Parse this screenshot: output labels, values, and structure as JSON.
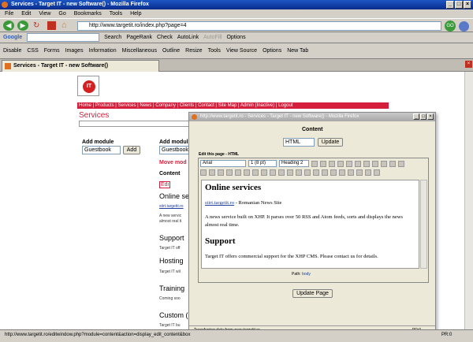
{
  "window": {
    "title": "Services - Target IT - new Software() - Mozilla Firefox"
  },
  "menu": [
    "File",
    "Edit",
    "View",
    "Go",
    "Bookmarks",
    "Tools",
    "Help"
  ],
  "url": "http://www.targetit.ro/index.php?page=4",
  "google_toolbar": {
    "label": "Google",
    "items": [
      "Search",
      "PageRank",
      "Check",
      "AutoLink",
      "AutoFill",
      "Options"
    ]
  },
  "webdev_toolbar": [
    "Disable",
    "CSS",
    "Forms",
    "Images",
    "Information",
    "Miscellaneous",
    "Outline",
    "Resize",
    "Tools",
    "View Source",
    "Options"
  ],
  "new_tab": "New Tab",
  "tab": {
    "title": "Services - Target IT - new Software()"
  },
  "site": {
    "nav": "Home | Products | Services | News | Company | Clients | Contact | Site Map | Admin (Inactive) | Logout",
    "page_title": "Services",
    "logo_text": "IT",
    "add_module_label": "Add module",
    "add_module_select": "Guestbook",
    "add_button": "Add",
    "add_module_label_2": "Add modul",
    "move_module": "Move mod",
    "content_label": "Content",
    "edit_link": "Edi",
    "sections": [
      {
        "heading": "Online se",
        "lines": [
          "stirt.targetit.ro",
          "A new servic",
          "almost real ti"
        ]
      },
      {
        "heading": "Support",
        "lines": [
          "Target IT off"
        ]
      },
      {
        "heading": "Hosting",
        "lines": [
          "Target IT wil"
        ]
      },
      {
        "heading": "Training",
        "lines": [
          "Coming soo"
        ]
      },
      {
        "heading": "Custom (",
        "lines": [
          "Target IT bu"
        ]
      }
    ]
  },
  "popup": {
    "title": "http://www.targetit.ro - Services - Target IT - new Software() - Mozilla Firefox",
    "content_label": "Content",
    "format_select": "HTML",
    "update_button": "Update",
    "edit_label": "Edit this page - HTML",
    "font_select": "Arial",
    "size_select": "1 (8 pt)",
    "heading_select": "Heading 2",
    "doc": {
      "h1": "Online services",
      "link": "stirt.targetit.ro",
      "link_suffix": " - Romanian News Site",
      "p2": "A news service built on XHP. It parses over 50 RSS and Atom feeds, sorts and displays the news almost real time.",
      "h2": "Support",
      "p3": "Target IT offers commercial support for the XHP CMS. Please contact us for details."
    },
    "path_label": "Path:",
    "path_value": "body",
    "update_page_button": "Update Page",
    "status": "Transferring data from www.targetit.ro...",
    "status_right": "PR:0"
  },
  "statusbar": {
    "text": "http://www.targetit.ro/editwindow.php?module=content&action=display_edit_content&box",
    "right": "PR:0"
  }
}
